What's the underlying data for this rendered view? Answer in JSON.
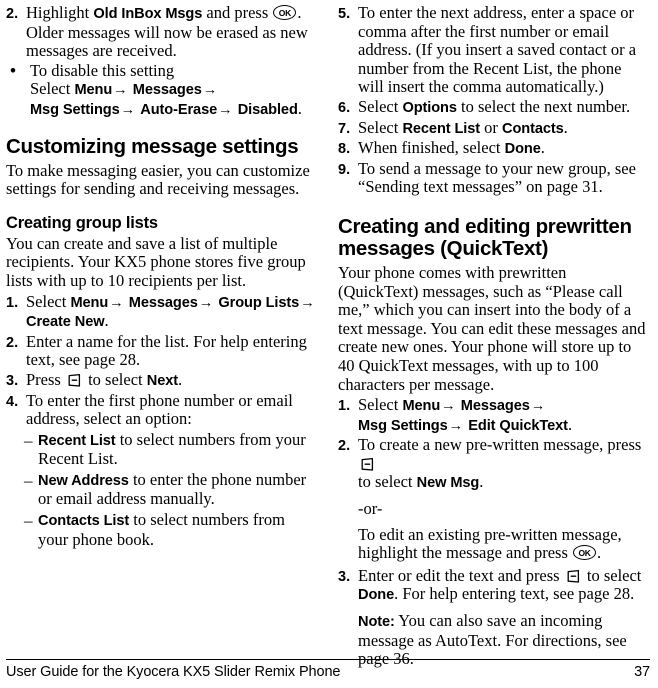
{
  "document": {
    "page_number": "37",
    "footer_title": "User Guide for the Kyocera KX5 Slider Remix Phone"
  },
  "icons": {
    "ok_key_label": "OK"
  },
  "left_column": {
    "step2": {
      "marker": "2.",
      "text_before_bold": "Highlight ",
      "bold1": "Old InBox Msgs",
      "text_mid": " and press ",
      "text_after": ". Older messages will now be erased as new messages are received."
    },
    "bullet": {
      "marker": "•",
      "line1": "To disable this setting",
      "line2_prefix": "Select ",
      "path": [
        "Menu",
        "Messages",
        "Msg Settings",
        "Auto-Erase",
        "Disabled"
      ],
      "period": "."
    },
    "heading_customizing": "Customizing message settings",
    "intro_customizing": "To make messaging easier, you can customize settings for sending and receiving messages.",
    "heading_group_lists": "Creating group lists",
    "intro_group_lists": "You can create and save a list of multiple recipients. Your KX5 phone stores five group lists with up to 10 recipients per list.",
    "step1": {
      "marker": "1.",
      "prefix": "Select ",
      "path": [
        "Menu",
        "Messages",
        "Group Lists",
        "Create New"
      ],
      "period": "."
    },
    "step2b": {
      "marker": "2.",
      "text": "Enter a name for the list. For help entering text, see page 28."
    },
    "step3": {
      "marker": "3.",
      "prefix": "Press ",
      "mid": " to select ",
      "bold": "Next",
      "period": "."
    },
    "step4": {
      "marker": "4.",
      "text": "To enter the first phone number or email address, select an option:"
    },
    "sub_items": [
      {
        "marker": "–",
        "bold": "Recent List",
        "text": " to select numbers from your Recent List."
      },
      {
        "marker": "–",
        "bold": "New Address",
        "text": " to enter the phone number or email address manually."
      },
      {
        "marker": "–",
        "bold": "Contacts List",
        "text": " to select numbers from your phone book."
      }
    ]
  },
  "right_column": {
    "step5": {
      "marker": "5.",
      "text": "To enter the next address, enter a space or comma after the first number or email address. (If you insert a saved contact or a number from the Recent List, the phone will insert the comma automatically.)"
    },
    "step6": {
      "marker": "6.",
      "prefix": "Select ",
      "bold": "Options",
      "suffix": " to select the next number."
    },
    "step7": {
      "marker": "7.",
      "prefix": "Select ",
      "bold1": "Recent List",
      "mid": " or ",
      "bold2": "Contacts",
      "period": "."
    },
    "step8": {
      "marker": "8.",
      "prefix": "When finished, select ",
      "bold": "Done",
      "period": "."
    },
    "step9": {
      "marker": "9.",
      "text": "To send a message to your new group, see “Sending text messages” on page 31."
    },
    "heading_quicktext": "Creating and editing prewritten messages (QuickText)",
    "intro_quicktext": "Your phone comes with prewritten (QuickText) messages, such as “Please call me,” which you can insert into the body of a text message. You can edit these messages and create new ones. Your phone will store up to 40 QuickText messages, with up to 100 characters per message.",
    "qt_step1": {
      "marker": "1.",
      "prefix": "Select ",
      "path": [
        "Menu",
        "Messages",
        "Msg Settings",
        "Edit QuickText"
      ],
      "period": "."
    },
    "qt_step2": {
      "marker": "2.",
      "prefix": "To create a new pre-written message, press ",
      "line2_prefix": "to select ",
      "bold": "New Msg",
      "period": ".",
      "or_text": "-or-",
      "alt_line1": "To edit an existing pre-written message,",
      "alt_line2_prefix": "highlight the message and press ",
      "alt_period": "."
    },
    "qt_step3": {
      "marker": "3.",
      "prefix": "Enter or edit the text and press ",
      "mid": " to select ",
      "bold": "Done",
      "suffix": ". For help entering text, see page 28."
    },
    "note": {
      "label": "Note:",
      "text": " You can also save an incoming message as AutoText. For directions, see page 36."
    }
  }
}
